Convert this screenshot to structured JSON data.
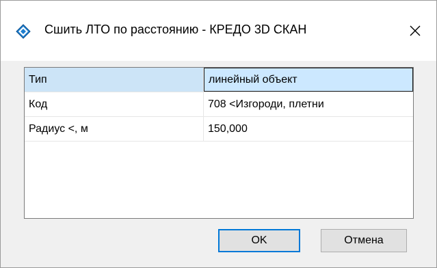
{
  "window": {
    "title": "Сшить ЛТО по расстоянию - КРЕДО 3D СКАН",
    "app_icon": "credo-diamond-icon",
    "close_icon": "close-icon"
  },
  "properties": [
    {
      "key": "Тип",
      "value": "линейный объект",
      "selected": true
    },
    {
      "key": "Код",
      "value": "708 <Изгороди, плетни"
    },
    {
      "key": "Радиус <, м",
      "value": "150,000"
    }
  ],
  "buttons": {
    "ok_label": "OK",
    "cancel_label": "Отмена"
  },
  "colors": {
    "selection": "#cce8ff",
    "default_button_border": "#0078d7",
    "app_icon_blue": "#1e7fd0"
  }
}
